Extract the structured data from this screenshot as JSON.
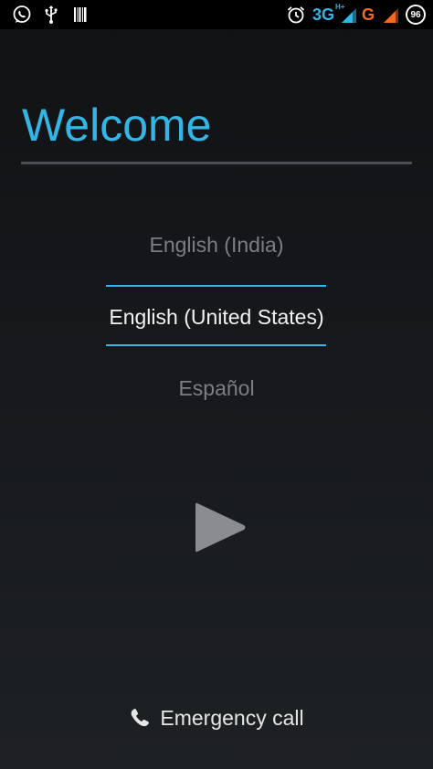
{
  "status_bar": {
    "left_icons": [
      "whatsapp-icon",
      "usb-icon",
      "barcode-icon"
    ],
    "right_icons": [
      "alarm-icon",
      "signal-3g-icon",
      "signal-g-icon"
    ],
    "network_primary": "3G",
    "network_primary_sub": "H+",
    "network_secondary": "G",
    "battery_level": "96",
    "colors": {
      "accent": "#33b5e5",
      "secondary_signal": "#f26a21",
      "icon": "#ffffff"
    }
  },
  "welcome": {
    "title": "Welcome",
    "title_color": "#33b5e5"
  },
  "language_picker": {
    "options": [
      "English (India)",
      "English (United States)",
      "Español"
    ],
    "selected_index": 1,
    "selection_color": "#33b5e5"
  },
  "next_button": {
    "icon": "play-arrow-icon",
    "color": "#8a8c8f"
  },
  "emergency": {
    "label": "Emergency call",
    "icon": "phone-icon"
  }
}
